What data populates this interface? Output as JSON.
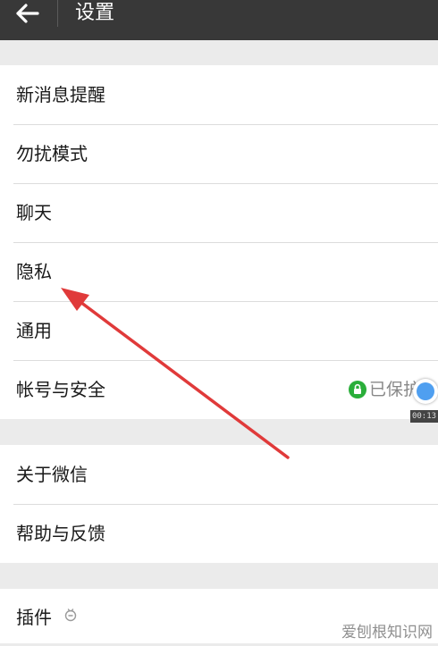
{
  "header": {
    "title": "设置"
  },
  "groups": [
    {
      "items": [
        {
          "label": "新消息提醒"
        },
        {
          "label": "勿扰模式"
        },
        {
          "label": "聊天"
        },
        {
          "label": "隐私"
        },
        {
          "label": "通用"
        },
        {
          "label": "帐号与安全",
          "status": "已保护"
        }
      ]
    },
    {
      "items": [
        {
          "label": "关于微信"
        },
        {
          "label": "帮助与反馈"
        }
      ]
    },
    {
      "items": [
        {
          "label": "插件"
        }
      ]
    }
  ],
  "overlay": {
    "timer": "00:13",
    "watermark": "爱刨根知识网"
  },
  "colors": {
    "header_bg": "#383838",
    "page_bg": "#ebebeb",
    "protect_green": "#2aae3a",
    "annotation_arrow": "#e03a3a"
  },
  "icons": {
    "back": "arrow-left-icon",
    "lock": "lock-icon",
    "plugin": "plugin-icon",
    "float_ball": "floating-ball-icon"
  }
}
